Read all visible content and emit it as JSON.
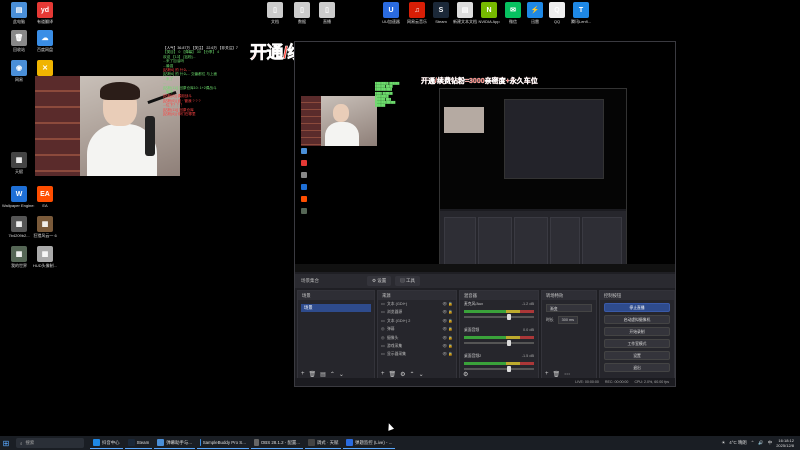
{
  "desktop_icons": [
    {
      "label": "此电脑",
      "color": "#4a8fd8",
      "glyph": "▤",
      "icon": "computer-icon"
    },
    {
      "label": "有道翻译",
      "color": "#e53935",
      "glyph": "yd",
      "icon": "youdao-icon"
    },
    {
      "label": "回收站",
      "color": "#888888",
      "glyph": "🗑",
      "icon": "recycle-bin-icon"
    },
    {
      "label": "百度网盘",
      "color": "#3a8ee6",
      "glyph": "☁",
      "icon": "baidu-netdisk-icon"
    },
    {
      "label": "网易",
      "color": "#4a8fd8",
      "glyph": "◉",
      "icon": "app-icon"
    },
    {
      "label": "软件",
      "color": "#f0b400",
      "glyph": "✕",
      "icon": "app-icon"
    },
    {
      "label": "文档",
      "color": "#cccccc",
      "glyph": "▯",
      "icon": "file-icon"
    },
    {
      "label": "数据",
      "color": "#cccccc",
      "glyph": "▯",
      "icon": "file-icon"
    },
    {
      "label": "直播",
      "color": "#cccccc",
      "glyph": "▯",
      "icon": "file-icon"
    },
    {
      "label": "UU加速器",
      "color": "#2a6be0",
      "glyph": "U",
      "icon": "uu-icon"
    },
    {
      "label": "网易云音乐",
      "color": "#d81e06",
      "glyph": "♫",
      "icon": "music-icon"
    },
    {
      "label": "Steam",
      "color": "#1b2838",
      "glyph": "S",
      "icon": "steam-icon"
    },
    {
      "label": "新建文本文档",
      "color": "#dddddd",
      "glyph": "▤",
      "icon": "text-file-icon"
    },
    {
      "label": "NVIDIA App",
      "color": "#76b900",
      "glyph": "N",
      "icon": "nvidia-icon"
    },
    {
      "label": "微信",
      "color": "#07c160",
      "glyph": "✉",
      "icon": "wechat-icon"
    },
    {
      "label": "迅雷",
      "color": "#1e88e5",
      "glyph": "⚡",
      "icon": "xunlei-icon"
    },
    {
      "label": "QQ",
      "color": "#eeeeee",
      "glyph": "Q",
      "icon": "qq-icon"
    },
    {
      "label": "腾讯Lenfl...",
      "color": "#1e88e5",
      "glyph": "T",
      "icon": "app-icon"
    },
    {
      "label": "天赋",
      "color": "#444444",
      "glyph": "▦",
      "icon": "app-icon"
    },
    {
      "label": "Wallpaper Engine: ...",
      "color": "#1e6fd6",
      "glyph": "W",
      "icon": "wallpaper-engine-icon"
    },
    {
      "label": "EA",
      "color": "#ff4e00",
      "glyph": "EA",
      "icon": "ea-icon"
    },
    {
      "label": "7b4209b2...",
      "color": "#555555",
      "glyph": "▦",
      "icon": "image-icon"
    },
    {
      "label": "狂猎风云一 6",
      "color": "#7a5a3a",
      "glyph": "▦",
      "icon": "game-icon"
    },
    {
      "label": "我的世界",
      "color": "#556655",
      "glyph": "▦",
      "icon": "game-icon"
    },
    {
      "label": "HUD头像制...",
      "color": "#aaaaaa",
      "glyph": "▦",
      "icon": "image-icon"
    }
  ],
  "stream": {
    "banner": "开通/续费钻粉=3000亲密度+永久车位",
    "chat": [
      {
        "text": "【人气】36.87万 【关注】 22.6万 【非关注】7",
        "color": "#f1f1f1"
      },
      {
        "text": "【类目】 0 【弹幕】 30 【分享】 4",
        "color": "#6ddc6d"
      },
      {
        "text": "欢迎 【13】 [钻粉]...",
        "color": "#6ddc6d"
      },
      {
        "text": "...来了加油吗",
        "color": "#6ddc6d"
      },
      {
        "text": "...最强",
        "color": "#6ddc6d"
      },
      {
        "text": "[钻粉6] 的 什么 ...",
        "color": "#ff4444"
      },
      {
        "text": "[钻粉6] 的 什么... 交番都位 与上面",
        "color": "#6ddc6d"
      },
      {
        "text": "...来了",
        "color": "#6ddc6d"
      },
      {
        "text": "...",
        "color": "#6ddc6d"
      },
      {
        "text": "[钻粉(11)] 回原仓库10: 1+2偶战斗",
        "color": "#6ddc6d"
      },
      {
        "text": "...偷不",
        "color": "#6ddc6d"
      },
      {
        "text": "[钻粉(6)] 偶用战斗",
        "color": "#ff4444"
      },
      {
        "text": "[钻粉(6)] 武 · 管我 ? ? ?",
        "color": "#ff4444"
      },
      {
        "text": "...位下？？？",
        "color": "#ff4444"
      },
      {
        "text": "[钻粉(11)] 回原仓库",
        "color": "#ff4444"
      },
      {
        "text": "[钻粉(6)] 你们在哪里",
        "color": "#ff4444"
      }
    ]
  },
  "obs": {
    "scene_header": "场景集合",
    "tabs": [
      "⚙ 设置",
      "▤ 工具"
    ],
    "scenes": {
      "title": "场景",
      "items": [
        "场景"
      ]
    },
    "sources": {
      "title": "来源",
      "items": [
        {
          "icon": "▭",
          "name": "文本 (GDI+)"
        },
        {
          "icon": "▭",
          "name": "浏览器源"
        },
        {
          "icon": "▭",
          "name": "文本 (GDI+) 2"
        },
        {
          "icon": "◎",
          "name": "弹幕"
        },
        {
          "icon": "◎",
          "name": "摄像头"
        },
        {
          "icon": "▭",
          "name": "游戏采集"
        },
        {
          "icon": "▭",
          "name": "显示器采集"
        }
      ]
    },
    "mixer": {
      "title": "混音器",
      "channels": [
        {
          "name": "麦克风/Aux",
          "db": "-1.2 dB"
        },
        {
          "name": "桌面音频",
          "db": "0.0 dB"
        },
        {
          "name": "桌面音频2",
          "db": "-1.5 dB"
        }
      ]
    },
    "transitions": {
      "title": "转场特效",
      "selected": "渐变",
      "duration_label": "时长",
      "duration_value": "300 ms"
    },
    "controls": {
      "title": "控制按钮",
      "buttons": [
        "停止直播",
        "启动虚拟摄像机",
        "开始录制",
        "工作室模式",
        "设置",
        "退出"
      ]
    },
    "status": {
      "live": "LIVE: 00:00:00",
      "rec": "REC: 00:00:00",
      "cpu": "CPU: 2.0%, 60.00 fps"
    }
  },
  "taskbar": {
    "search_placeholder": "搜索",
    "apps": [
      {
        "label": "抖音中心",
        "color": "#1e88e5"
      },
      {
        "label": "Steam",
        "color": "#1b2838"
      },
      {
        "label": "弹幕助手与...",
        "color": "#4a8fd8"
      },
      {
        "label": "SampleBuddy Pro S...",
        "color": "#3a8ee6"
      },
      {
        "label": "OBS 28.1.2 - 配置...",
        "color": "#666666"
      },
      {
        "label": "调式 · 天赋",
        "color": "#444444"
      },
      {
        "label": "弹题监控 (Live) - ...",
        "color": "#2a6be0"
      }
    ],
    "weather": "4°C 晴朗",
    "time": "16:18:12",
    "date": "2025/12/8",
    "lang": "中"
  }
}
